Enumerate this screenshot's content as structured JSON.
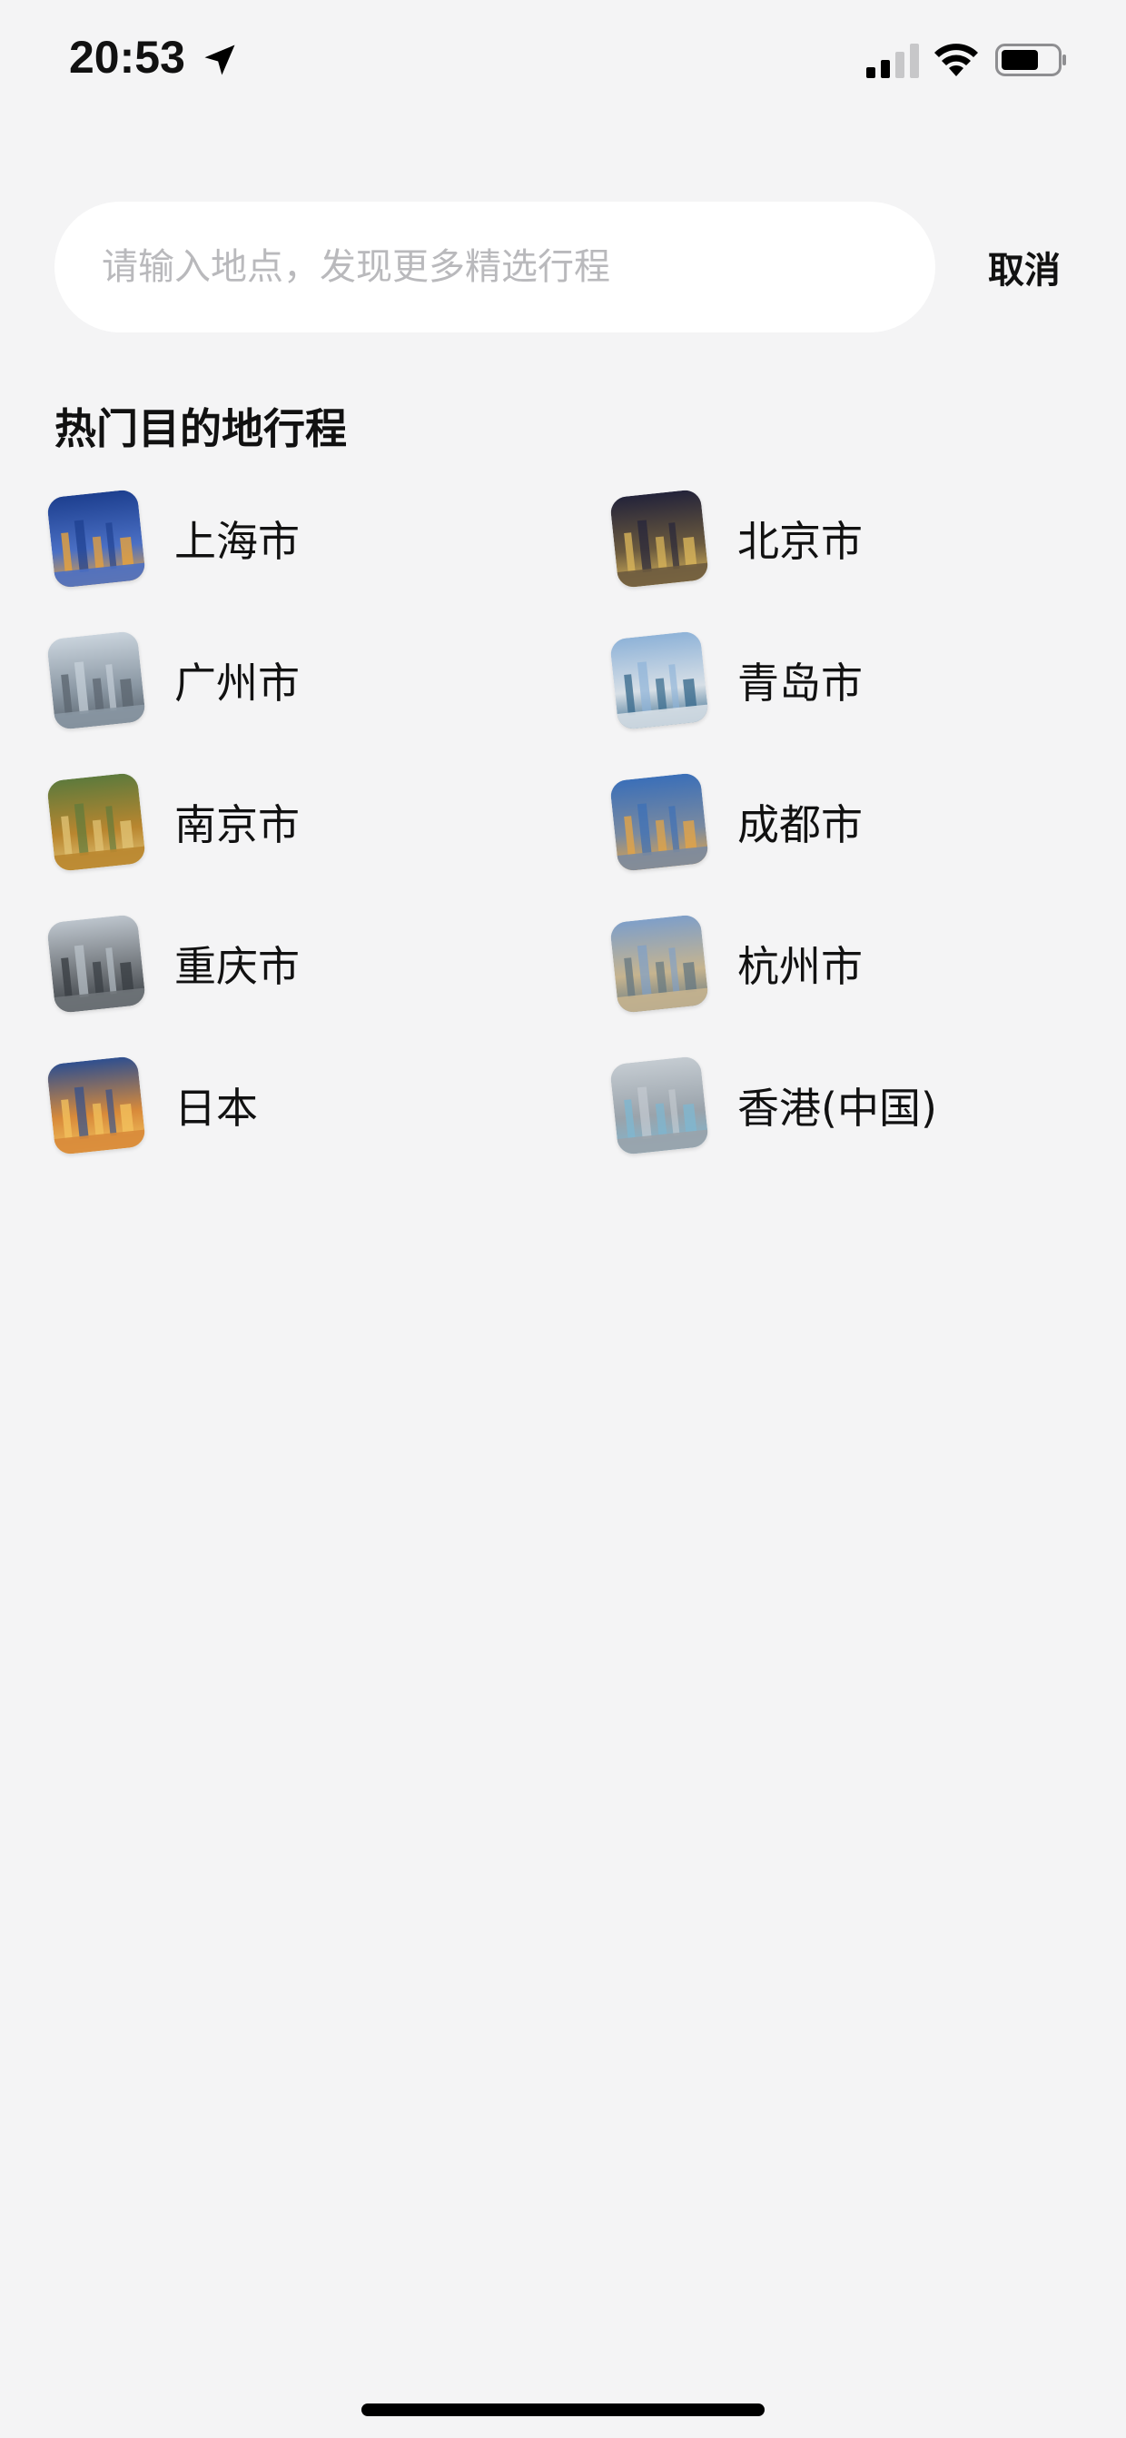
{
  "status_bar": {
    "time": "20:53",
    "icons": [
      "location-arrow-icon",
      "cellular-signal-icon",
      "wifi-icon",
      "battery-icon"
    ]
  },
  "search": {
    "placeholder": "请输入地点，发现更多精选行程",
    "value": "",
    "cancel_label": "取消"
  },
  "section": {
    "title": "热门目的地行程"
  },
  "destinations": [
    {
      "label": "上海市",
      "thumb_colors": [
        "#1d3f8f",
        "#4a6fc4",
        "#e9a23b"
      ]
    },
    {
      "label": "北京市",
      "thumb_colors": [
        "#23233a",
        "#6b5a3e",
        "#d8b45a"
      ]
    },
    {
      "label": "广州市",
      "thumb_colors": [
        "#c9d3dc",
        "#8a97a3",
        "#5c6670"
      ]
    },
    {
      "label": "青岛市",
      "thumb_colors": [
        "#8fb3d8",
        "#d7dfe6",
        "#3c6d8f"
      ]
    },
    {
      "label": "南京市",
      "thumb_colors": [
        "#5e7a3c",
        "#b9862f",
        "#e0c273"
      ]
    },
    {
      "label": "成都市",
      "thumb_colors": [
        "#3b6fb8",
        "#7a8aa0",
        "#e2a447"
      ]
    },
    {
      "label": "重庆市",
      "thumb_colors": [
        "#bcc4cc",
        "#6f7479",
        "#3a3f44"
      ]
    },
    {
      "label": "杭州市",
      "thumb_colors": [
        "#7f9fc8",
        "#c6b48f",
        "#6a7b82"
      ]
    },
    {
      "label": "日本",
      "thumb_colors": [
        "#2f4f8f",
        "#d88a3a",
        "#f2c15c"
      ]
    },
    {
      "label": "香港(中国)",
      "thumb_colors": [
        "#c4cbd1",
        "#9aa3ab",
        "#7fb6cf"
      ]
    }
  ]
}
